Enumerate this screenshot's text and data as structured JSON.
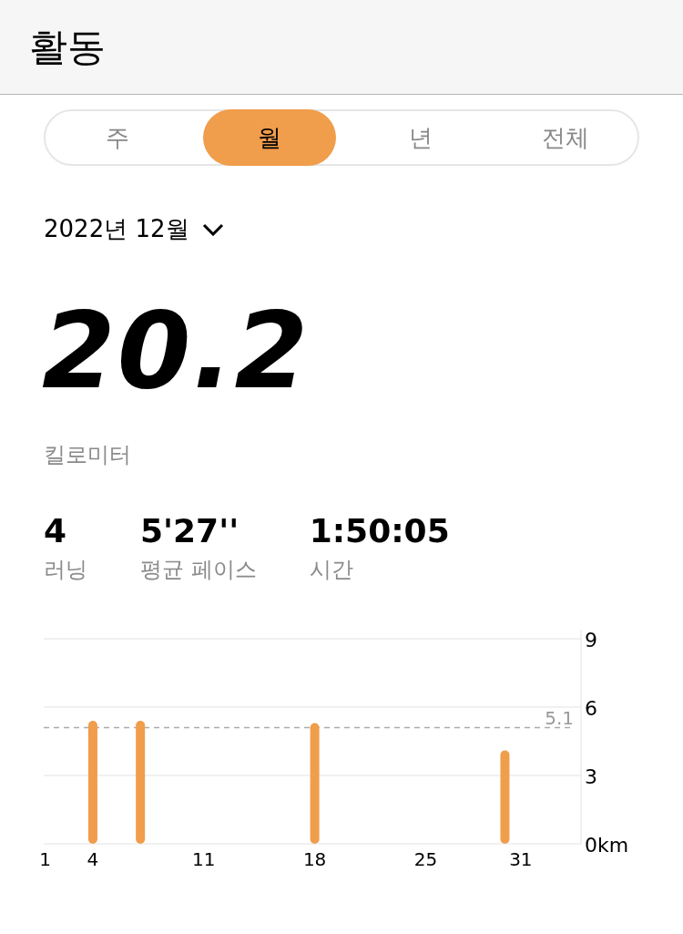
{
  "header": {
    "title": "활동"
  },
  "tabs": [
    {
      "label": "주",
      "selected": false
    },
    {
      "label": "월",
      "selected": true
    },
    {
      "label": "년",
      "selected": false
    },
    {
      "label": "전체",
      "selected": false
    }
  ],
  "period": {
    "label": "2022년 12월"
  },
  "total": {
    "value": "20.2",
    "unit": "킬로미터"
  },
  "stats": [
    {
      "value": "4",
      "label": "러닝"
    },
    {
      "value": "5'27''",
      "label": "평균 페이스"
    },
    {
      "value": "1:50:05",
      "label": "시간"
    }
  ],
  "chart": {
    "chart_data": {
      "type": "bar",
      "x": [
        4,
        7,
        18,
        30
      ],
      "series": [
        {
          "color": "#f09d4c",
          "values": [
            5.4,
            5.4,
            5.3,
            4.1
          ]
        }
      ],
      "xlim": [
        0.9,
        34.8
      ],
      "ylim": [
        0,
        9
      ],
      "xticks": [
        1,
        4,
        11,
        18,
        25,
        31
      ],
      "yticks": [
        {
          "value": 0,
          "label": "0km"
        },
        3,
        6,
        9
      ],
      "ref_lines": [
        {
          "axis": "y",
          "value": 5.1,
          "label": "5.1"
        }
      ]
    }
  }
}
